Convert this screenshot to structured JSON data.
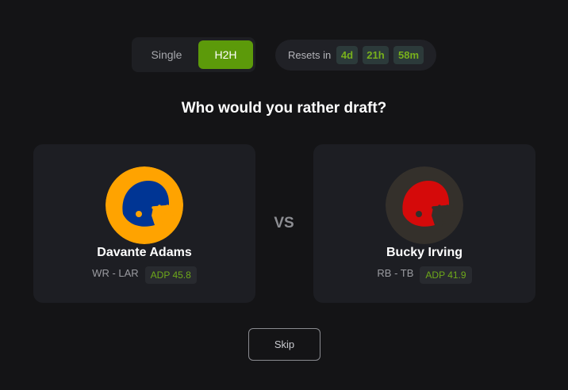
{
  "mode_toggle": {
    "single_label": "Single",
    "h2h_label": "H2H",
    "selected": "H2H",
    "accent_color": "#5c9a0a"
  },
  "resets": {
    "label": "Resets in",
    "days": "4d",
    "hours": "21h",
    "minutes": "58m"
  },
  "question": "Who would you rather draft?",
  "vs_label": "VS",
  "players": [
    {
      "name": "Davante Adams",
      "pos_team": "WR - LAR",
      "adp": "ADP 45.8",
      "icon": "football-helmet-icon",
      "helmet_color": "#003594",
      "background_color": "#ffa300"
    },
    {
      "name": "Bucky Irving",
      "pos_team": "RB - TB",
      "adp": "ADP 41.9",
      "icon": "football-helmet-icon",
      "helmet_color": "#d50a0a",
      "background_color": "#34302b"
    }
  ],
  "skip_label": "Skip"
}
